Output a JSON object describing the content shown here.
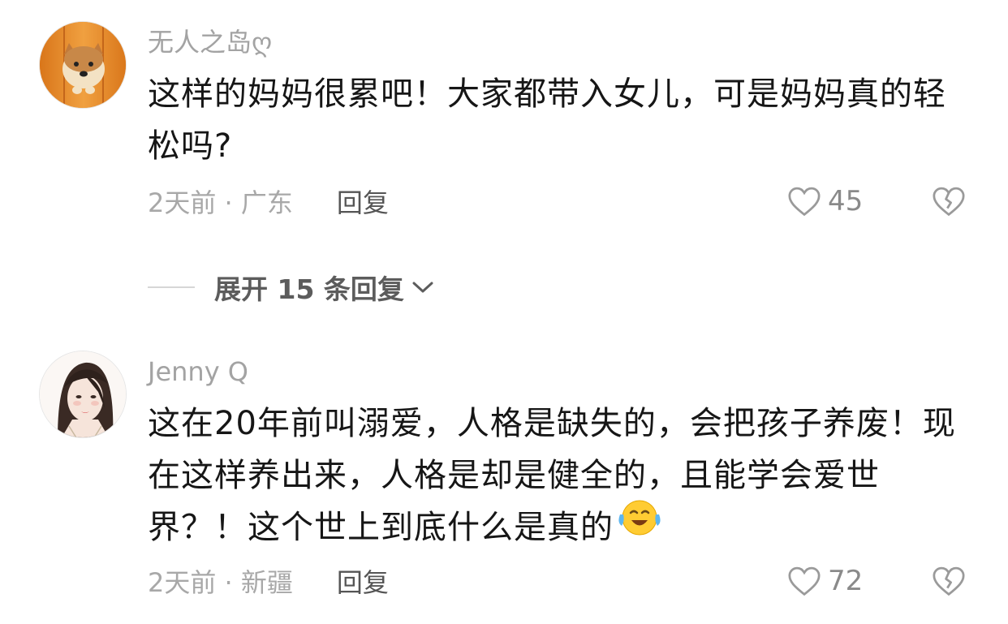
{
  "comments": [
    {
      "username": "无人之岛ღ",
      "text": "这样的妈妈很累吧！大家都带入女儿，可是妈妈真的轻松吗?",
      "meta": "2天前 · 广东",
      "reply_label": "回复",
      "likes": "45"
    },
    {
      "username": "Jenny Q",
      "text": "这在20年前叫溺爱，人格是缺失的，会把孩子养废！现在这样养出来，人格是却是健全的，且能学会爱世界？！这个世上到底什么是真的",
      "meta": "2天前 · 新疆",
      "reply_label": "回复",
      "likes": "72",
      "emoji": "crying-laughing-emoji"
    }
  ],
  "expand_replies": {
    "label": "展开 15 条回复"
  },
  "colors": {
    "username": "#a3a3a3",
    "text": "#161616",
    "meta": "#a8a8a8",
    "reply": "#555555",
    "icon": "#9a9a9a"
  }
}
